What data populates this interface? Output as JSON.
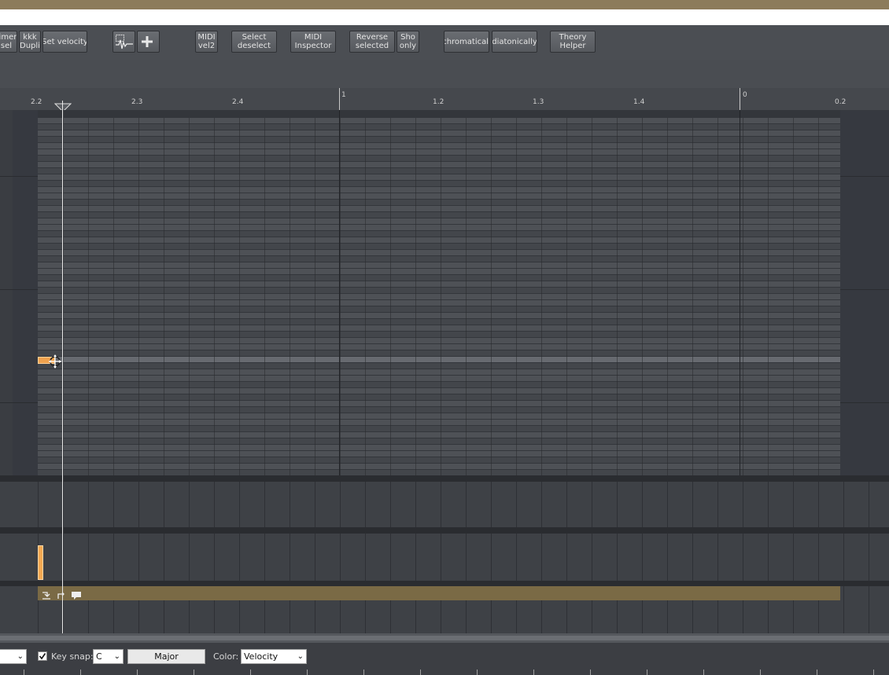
{
  "toolbar": {
    "buttons": [
      {
        "id": "timer-sel",
        "label": "timer\nsel"
      },
      {
        "id": "kkk-dupli",
        "label": "kkk\nDupli"
      },
      {
        "id": "set-velocity",
        "label": "Set velocity"
      },
      {
        "id": "midi-vel2",
        "label": "MIDI\nvel2"
      },
      {
        "id": "select-deselect",
        "label": "Select\ndeselect"
      },
      {
        "id": "midi-inspector",
        "label": "MIDI\nInspector"
      },
      {
        "id": "reverse-selected",
        "label": "Reverse\nselected"
      },
      {
        "id": "show-only",
        "label": "Sho\nonly"
      },
      {
        "id": "chromatically",
        "label": "chromaticall"
      },
      {
        "id": "diatonically",
        "label": "diatonically"
      },
      {
        "id": "theory-helper",
        "label": "Theory\nHelper"
      }
    ],
    "icons": [
      "waveform-select-icon",
      "plus-icon"
    ]
  },
  "ruler": {
    "labels": [
      "2.2",
      "2.3",
      "2.4",
      "1",
      "1.2",
      "1.3",
      "1.4",
      "0",
      "0.2"
    ]
  },
  "status": {
    "key_snap_label": "Key snap:",
    "key_snap_checked": true,
    "key_value": "C",
    "scale_value": "Major",
    "color_label": "Color:",
    "color_value": "Velocity"
  },
  "colors": {
    "note": "#f0a24e",
    "region": "#7a6a45",
    "background": "#3c3e43"
  }
}
